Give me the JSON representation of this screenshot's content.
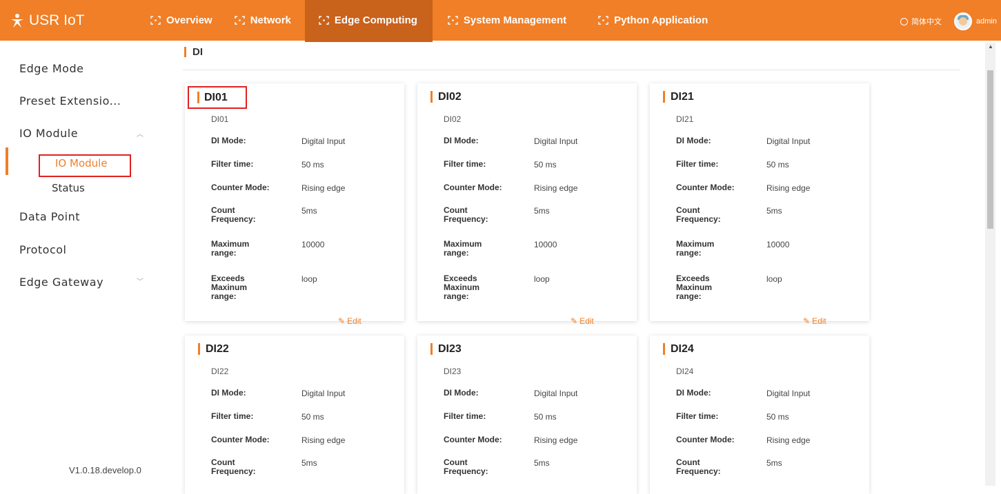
{
  "app": {
    "brand": "USR IoT",
    "language": "简体中文",
    "user": "admin",
    "version": "V1.0.18.develop.0"
  },
  "nav": {
    "items": [
      {
        "label": "Overview",
        "active": false
      },
      {
        "label": "Network",
        "active": false
      },
      {
        "label": "Edge Computing",
        "active": true
      },
      {
        "label": "System Management",
        "active": false
      },
      {
        "label": "Python Application",
        "active": false
      }
    ]
  },
  "sidebar": {
    "edge_mode": "Edge Mode",
    "preset": "Preset Extensio...",
    "io_module": "IO Module",
    "io_module_sub": "IO Module",
    "status": "Status",
    "data_point": "Data Point",
    "protocol": "Protocol",
    "edge_gateway": "Edge Gateway"
  },
  "section": {
    "title": "DI"
  },
  "labels": {
    "di_mode": "DI Mode:",
    "filter_time": "Filter time:",
    "counter_mode": "Counter Mode:",
    "count_frequency": "Count Frequency:",
    "maximum_range": "Maximum range:",
    "exceeds": "Exceeds Maxinum range:",
    "edit": "Edit"
  },
  "cards": [
    {
      "title": "DI01",
      "name": "DI01",
      "di_mode": "Digital Input",
      "filter_time": "50 ms",
      "counter_mode": "Rising edge",
      "count_frequency": "5ms",
      "maximum_range": "10000",
      "exceeds": "loop"
    },
    {
      "title": "DI02",
      "name": "DI02",
      "di_mode": "Digital Input",
      "filter_time": "50 ms",
      "counter_mode": "Rising edge",
      "count_frequency": "5ms",
      "maximum_range": "10000",
      "exceeds": "loop"
    },
    {
      "title": "DI21",
      "name": "DI21",
      "di_mode": "Digital Input",
      "filter_time": "50 ms",
      "counter_mode": "Rising edge",
      "count_frequency": "5ms",
      "maximum_range": "10000",
      "exceeds": "loop"
    },
    {
      "title": "DI22",
      "name": "DI22",
      "di_mode": "Digital Input",
      "filter_time": "50 ms",
      "counter_mode": "Rising edge",
      "count_frequency": "5ms"
    },
    {
      "title": "DI23",
      "name": "DI23",
      "di_mode": "Digital Input",
      "filter_time": "50 ms",
      "counter_mode": "Rising edge",
      "count_frequency": "5ms"
    },
    {
      "title": "DI24",
      "name": "DI24",
      "di_mode": "Digital Input",
      "filter_time": "50 ms",
      "counter_mode": "Rising edge",
      "count_frequency": "5ms"
    }
  ],
  "colors": {
    "accent": "#f07f27",
    "active_nav": "#c9621b",
    "highlight_box": "#e02020"
  }
}
